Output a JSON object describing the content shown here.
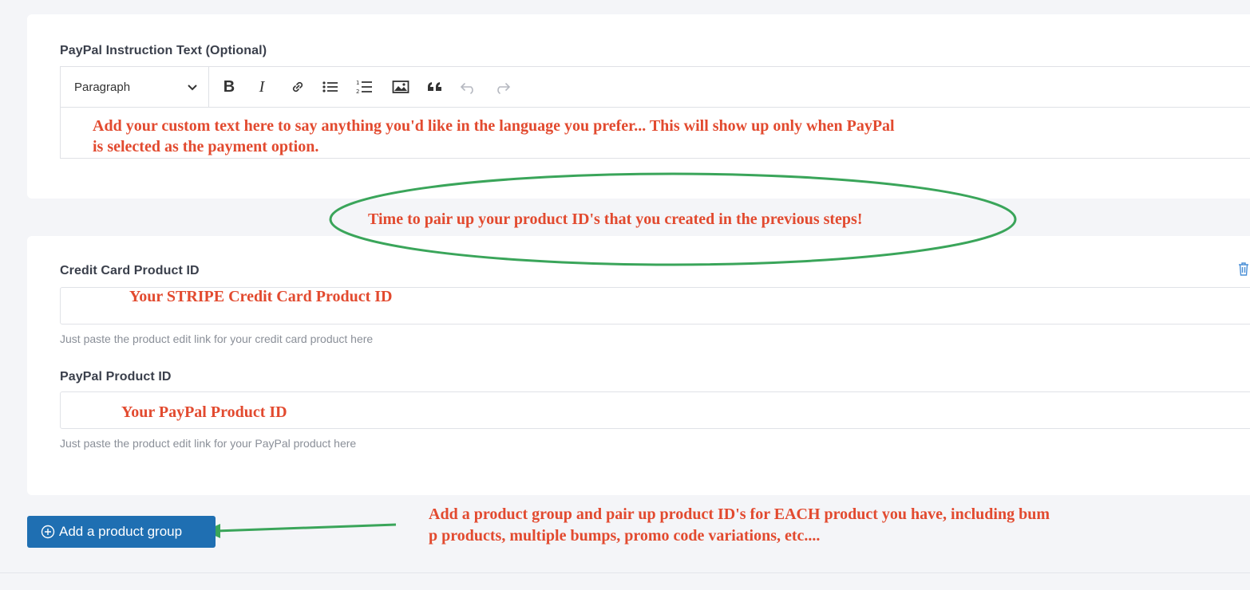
{
  "paypal_section": {
    "label": "PayPal Instruction Text (Optional)",
    "block_format": "Paragraph",
    "toolbar": {
      "bold": "B",
      "italic": "I"
    },
    "content_line1": "Add your custom text here to say anything you'd like in the language you prefer... This will show up only when PayPal",
    "content_line2": "is selected as the payment option."
  },
  "callout_oval": {
    "text": "Time to pair up your product ID's that you created in the previous steps!",
    "color": "#3aa55a"
  },
  "product_group": {
    "credit_card": {
      "label": "Credit Card Product ID",
      "value": "Your STRIPE Credit Card Product ID",
      "help": "Just paste the product edit link for your credit card product here"
    },
    "paypal": {
      "label": "PayPal Product ID",
      "value": "Your PayPal Product ID",
      "help": "Just paste the product edit link for your PayPal product here"
    }
  },
  "add_group_button": {
    "label": "Add a product group",
    "color": "#1f6fb2"
  },
  "bottom_note": {
    "line1": "Add a product group and pair up product ID's for EACH product you have, including bum",
    "line2": "p products, multiple bumps, promo code variations, etc...."
  },
  "annotation_color": "#e24a2f"
}
